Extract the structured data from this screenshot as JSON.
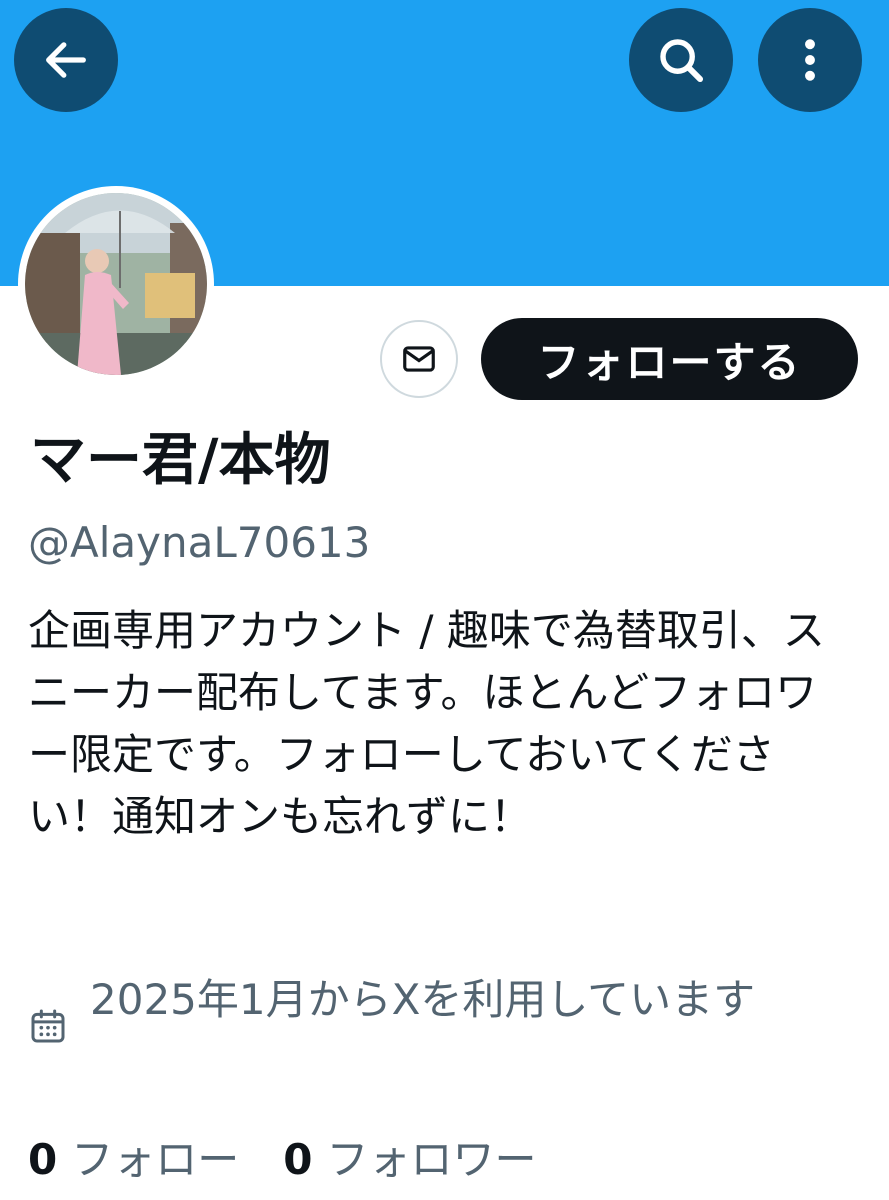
{
  "header": {
    "back_icon": "arrow-left-icon",
    "search_icon": "search-icon",
    "more_icon": "more-vertical-icon",
    "banner_color": "#1da1f2"
  },
  "profile": {
    "display_name": "マー君/本物",
    "handle": "@AlaynaL70613",
    "bio": "企画専用アカウント / 趣味で為替取引、スニーカー配布してます。ほとんどフォロワー限定です。フォローしておいてください！通知オンも忘れずに！",
    "joined": "2025年1月からXを利用しています",
    "joined_icon": "calendar-icon"
  },
  "actions": {
    "message_icon": "mail-icon",
    "follow_label": "フォローする"
  },
  "stats": {
    "following_count": "0",
    "following_label": "フォロー",
    "followers_count": "0",
    "followers_label": "フォロワー"
  }
}
